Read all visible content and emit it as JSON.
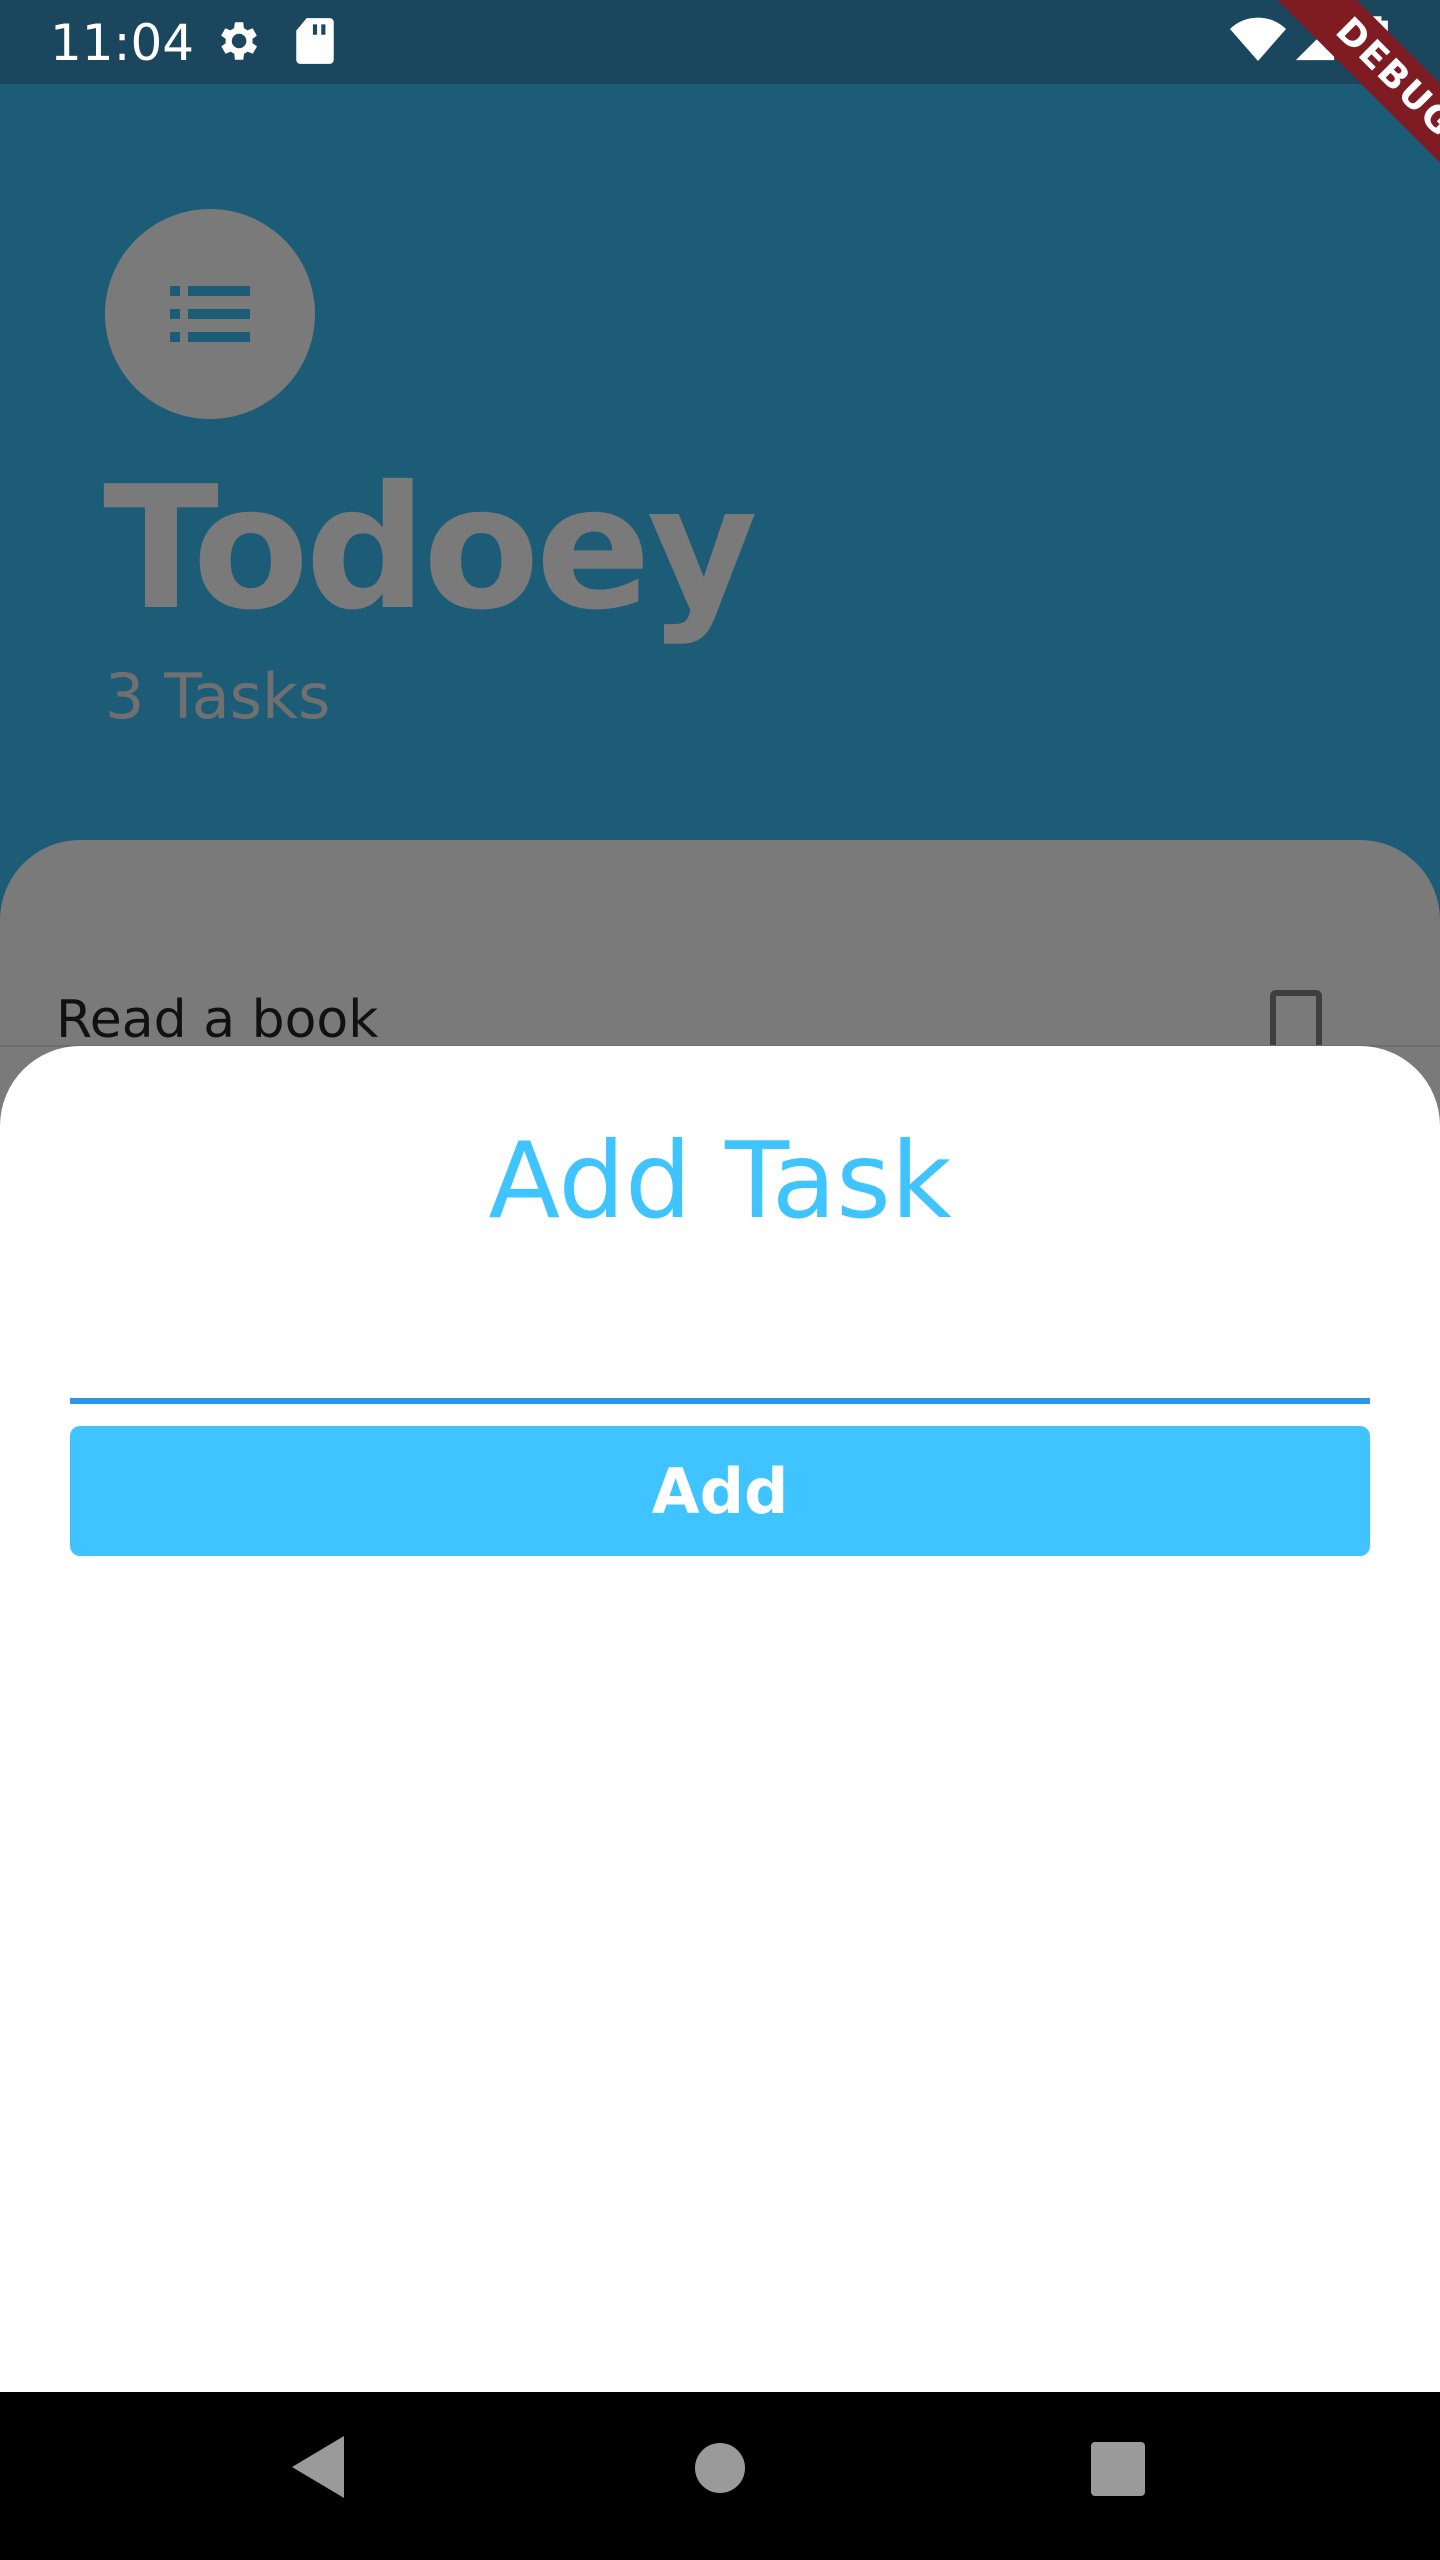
{
  "status_bar": {
    "time": "11:04",
    "icons": [
      "gear-icon",
      "sd-card-icon",
      "wifi-icon",
      "signal-icon",
      "battery-icon"
    ]
  },
  "debug_banner": "DEBUG",
  "header": {
    "icon": "list-icon",
    "title": "Todoey",
    "task_count": "3 Tasks"
  },
  "tasks": [
    {
      "title": "Read a book",
      "checked": false
    }
  ],
  "sheet": {
    "title": "Add Task",
    "input_value": "",
    "button_label": "Add"
  },
  "nav": {
    "icons": [
      "back-icon",
      "home-icon",
      "recents-icon"
    ]
  },
  "colors": {
    "accent": "#40c4ff",
    "header_bg": "#1d5c77",
    "status_bg": "#1b475e",
    "input_underline": "#2a96e8"
  }
}
